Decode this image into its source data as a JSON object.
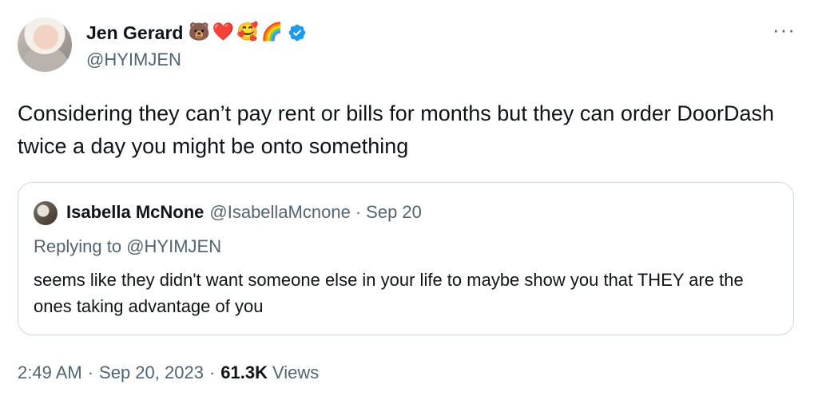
{
  "tweet": {
    "author": {
      "display_name": "Jen Gerard",
      "emojis": [
        "🐻",
        "❤️",
        "🥰",
        "🌈"
      ],
      "handle": "@HYIMJEN",
      "verified": true
    },
    "more_label": "···",
    "text": "Considering they can’t pay rent or bills for months but they can order DoorDash twice a day you might be onto something"
  },
  "quote": {
    "author": {
      "display_name": "Isabella McNone",
      "handle": "@IsabellaMcnone",
      "separator": "·",
      "date": "Sep 20"
    },
    "replying_prefix": "Replying to",
    "replying_handle": "@HYIMJEN",
    "text": "seems like they didn't want someone else in your life to maybe show you that THEY are the ones taking advantage of you"
  },
  "meta": {
    "time": "2:49 AM",
    "separator": "·",
    "date": "Sep 20, 2023",
    "views_count": "61.3K",
    "views_label": "Views"
  },
  "colors": {
    "verified_badge": "#1d9bf0",
    "secondary_text": "#536471",
    "primary_text": "#0f1419",
    "border": "#cfd9de"
  }
}
